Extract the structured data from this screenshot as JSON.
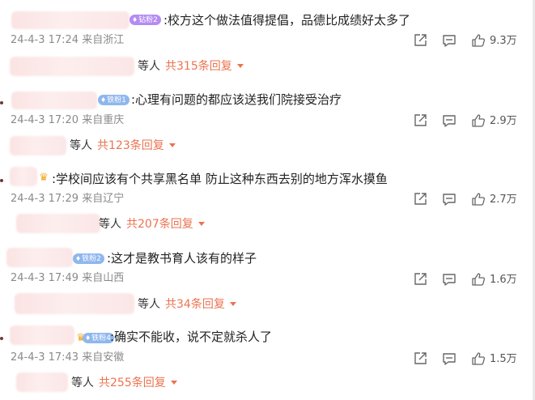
{
  "comments": [
    {
      "badge": "钻粉2",
      "text": ":校方这个做法值得提倡，品德比成绩好太多了",
      "timestamp": "24-4-3 17:24",
      "location": "来自浙江",
      "likes": "9.3万",
      "reply_etc": "等人",
      "reply_link": "共315条回复"
    },
    {
      "badge": "铁粉1",
      "text": ":心理有问题的都应该送我们院接受治疗",
      "timestamp": "24-4-3 17:20",
      "location": "来自重庆",
      "likes": "2.9万",
      "reply_etc": "等人",
      "reply_link": "共123条回复"
    },
    {
      "badge": "",
      "text": ":学校间应该有个共享黑名单 防止这种东西去别的地方浑水摸鱼",
      "timestamp": "24-4-3 17:29",
      "location": "来自辽宁",
      "likes": "2.7万",
      "reply_etc": "等人",
      "reply_link": "共207条回复"
    },
    {
      "badge": "铁粉2",
      "text": ":这才是教书育人该有的样子",
      "timestamp": "24-4-3 17:49",
      "location": "来自山西",
      "likes": "1.6万",
      "reply_etc": "等人",
      "reply_link": "共34条回复"
    },
    {
      "badge": "铁粉4",
      "text": ":确实不能收，说不定就杀人了",
      "timestamp": "24-4-3 17:43",
      "location": "来自安徽",
      "likes": "1.5万",
      "reply_etc": "等人",
      "reply_link": "共255条回复"
    }
  ],
  "icons": {
    "share": "share-icon",
    "comment": "comment-icon",
    "like": "thumbs-up-icon",
    "reply_expand": "chevron-down-icon",
    "badge_gem": "diamond-icon",
    "crown": "crown-icon"
  },
  "colors": {
    "accent": "#eb7350",
    "meta": "#8a8a8a",
    "badge_purple": "#b58cf2",
    "badge_blue": "#8fb7ee"
  }
}
